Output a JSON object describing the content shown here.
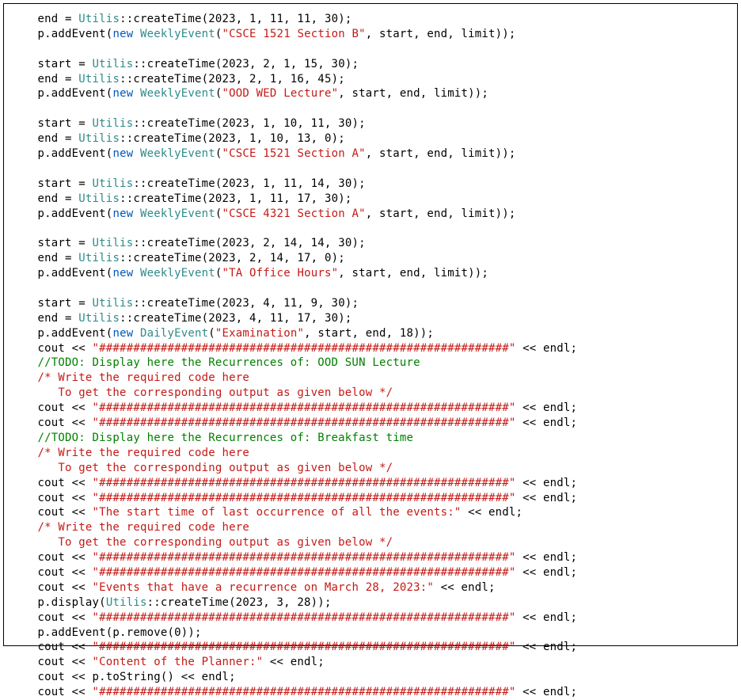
{
  "code": {
    "indent": "    ",
    "lines": [
      {
        "segs": [
          {
            "t": "end = ",
            "c": "blk"
          },
          {
            "t": "Utilis",
            "c": "tcl"
          },
          {
            "t": "::createTime(2023, 1, 11, 11, 30);",
            "c": "blk"
          }
        ]
      },
      {
        "segs": [
          {
            "t": "p.addEvent(",
            "c": "blk"
          },
          {
            "t": "new",
            "c": "kw"
          },
          {
            "t": " ",
            "c": "blk"
          },
          {
            "t": "WeeklyEvent",
            "c": "tcl"
          },
          {
            "t": "(",
            "c": "blk"
          },
          {
            "t": "\"CSCE 1521 Section B\"",
            "c": "str"
          },
          {
            "t": ", start, end, limit));",
            "c": "blk"
          }
        ]
      },
      {
        "segs": [
          {
            "t": "",
            "c": "blk"
          }
        ]
      },
      {
        "segs": [
          {
            "t": "start = ",
            "c": "blk"
          },
          {
            "t": "Utilis",
            "c": "tcl"
          },
          {
            "t": "::createTime(2023, 2, 1, 15, 30);",
            "c": "blk"
          }
        ]
      },
      {
        "segs": [
          {
            "t": "end = ",
            "c": "blk"
          },
          {
            "t": "Utilis",
            "c": "tcl"
          },
          {
            "t": "::createTime(2023, 2, 1, 16, 45);",
            "c": "blk"
          }
        ]
      },
      {
        "segs": [
          {
            "t": "p.addEvent(",
            "c": "blk"
          },
          {
            "t": "new",
            "c": "kw"
          },
          {
            "t": " ",
            "c": "blk"
          },
          {
            "t": "WeeklyEvent",
            "c": "tcl"
          },
          {
            "t": "(",
            "c": "blk"
          },
          {
            "t": "\"OOD WED Lecture\"",
            "c": "str"
          },
          {
            "t": ", start, end, limit));",
            "c": "blk"
          }
        ]
      },
      {
        "segs": [
          {
            "t": "",
            "c": "blk"
          }
        ]
      },
      {
        "segs": [
          {
            "t": "start = ",
            "c": "blk"
          },
          {
            "t": "Utilis",
            "c": "tcl"
          },
          {
            "t": "::createTime(2023, 1, 10, 11, 30);",
            "c": "blk"
          }
        ]
      },
      {
        "segs": [
          {
            "t": "end = ",
            "c": "blk"
          },
          {
            "t": "Utilis",
            "c": "tcl"
          },
          {
            "t": "::createTime(2023, 1, 10, 13, 0);",
            "c": "blk"
          }
        ]
      },
      {
        "segs": [
          {
            "t": "p.addEvent(",
            "c": "blk"
          },
          {
            "t": "new",
            "c": "kw"
          },
          {
            "t": " ",
            "c": "blk"
          },
          {
            "t": "WeeklyEvent",
            "c": "tcl"
          },
          {
            "t": "(",
            "c": "blk"
          },
          {
            "t": "\"CSCE 1521 Section A\"",
            "c": "str"
          },
          {
            "t": ", start, end, limit));",
            "c": "blk"
          }
        ]
      },
      {
        "segs": [
          {
            "t": "",
            "c": "blk"
          }
        ]
      },
      {
        "segs": [
          {
            "t": "start = ",
            "c": "blk"
          },
          {
            "t": "Utilis",
            "c": "tcl"
          },
          {
            "t": "::createTime(2023, 1, 11, 14, 30);",
            "c": "blk"
          }
        ]
      },
      {
        "segs": [
          {
            "t": "end = ",
            "c": "blk"
          },
          {
            "t": "Utilis",
            "c": "tcl"
          },
          {
            "t": "::createTime(2023, 1, 11, 17, 30);",
            "c": "blk"
          }
        ]
      },
      {
        "segs": [
          {
            "t": "p.addEvent(",
            "c": "blk"
          },
          {
            "t": "new",
            "c": "kw"
          },
          {
            "t": " ",
            "c": "blk"
          },
          {
            "t": "WeeklyEvent",
            "c": "tcl"
          },
          {
            "t": "(",
            "c": "blk"
          },
          {
            "t": "\"CSCE 4321 Section A\"",
            "c": "str"
          },
          {
            "t": ", start, end, limit));",
            "c": "blk"
          }
        ]
      },
      {
        "segs": [
          {
            "t": "",
            "c": "blk"
          }
        ]
      },
      {
        "segs": [
          {
            "t": "start = ",
            "c": "blk"
          },
          {
            "t": "Utilis",
            "c": "tcl"
          },
          {
            "t": "::createTime(2023, 2, 14, 14, 30);",
            "c": "blk"
          }
        ]
      },
      {
        "segs": [
          {
            "t": "end = ",
            "c": "blk"
          },
          {
            "t": "Utilis",
            "c": "tcl"
          },
          {
            "t": "::createTime(2023, 2, 14, 17, 0);",
            "c": "blk"
          }
        ]
      },
      {
        "segs": [
          {
            "t": "p.addEvent(",
            "c": "blk"
          },
          {
            "t": "new",
            "c": "kw"
          },
          {
            "t": " ",
            "c": "blk"
          },
          {
            "t": "WeeklyEvent",
            "c": "tcl"
          },
          {
            "t": "(",
            "c": "blk"
          },
          {
            "t": "\"TA Office Hours\"",
            "c": "str"
          },
          {
            "t": ", start, end, limit));",
            "c": "blk"
          }
        ]
      },
      {
        "segs": [
          {
            "t": "",
            "c": "blk"
          }
        ]
      },
      {
        "segs": [
          {
            "t": "start = ",
            "c": "blk"
          },
          {
            "t": "Utilis",
            "c": "tcl"
          },
          {
            "t": "::createTime(2023, 4, 11, 9, 30);",
            "c": "blk"
          }
        ]
      },
      {
        "segs": [
          {
            "t": "end = ",
            "c": "blk"
          },
          {
            "t": "Utilis",
            "c": "tcl"
          },
          {
            "t": "::createTime(2023, 4, 11, 17, 30);",
            "c": "blk"
          }
        ]
      },
      {
        "segs": [
          {
            "t": "p.addEvent(",
            "c": "blk"
          },
          {
            "t": "new",
            "c": "kw"
          },
          {
            "t": " ",
            "c": "blk"
          },
          {
            "t": "DailyEvent",
            "c": "tcl"
          },
          {
            "t": "(",
            "c": "blk"
          },
          {
            "t": "\"Examination\"",
            "c": "str"
          },
          {
            "t": ", start, end, 18));",
            "c": "blk"
          }
        ]
      },
      {
        "segs": [
          {
            "t": "cout << ",
            "c": "blk"
          },
          {
            "t": "\"############################################################\"",
            "c": "str"
          },
          {
            "t": " << endl;",
            "c": "blk"
          }
        ]
      },
      {
        "segs": [
          {
            "t": "//TODO: Display here the Recurrences of: OOD SUN Lecture",
            "c": "cmt"
          }
        ]
      },
      {
        "segs": [
          {
            "t": "/* Write the required code here",
            "c": "cmtb"
          }
        ]
      },
      {
        "segs": [
          {
            "t": "   To get the corresponding output as given below */",
            "c": "cmtb"
          }
        ]
      },
      {
        "segs": [
          {
            "t": "cout << ",
            "c": "blk"
          },
          {
            "t": "\"############################################################\"",
            "c": "str"
          },
          {
            "t": " << endl;",
            "c": "blk"
          }
        ]
      },
      {
        "segs": [
          {
            "t": "cout << ",
            "c": "blk"
          },
          {
            "t": "\"############################################################\"",
            "c": "str"
          },
          {
            "t": " << endl;",
            "c": "blk"
          }
        ]
      },
      {
        "segs": [
          {
            "t": "//TODO: Display here the Recurrences of: Breakfast time",
            "c": "cmt"
          }
        ]
      },
      {
        "segs": [
          {
            "t": "/* Write the required code here",
            "c": "cmtb"
          }
        ]
      },
      {
        "segs": [
          {
            "t": "   To get the corresponding output as given below */",
            "c": "cmtb"
          }
        ]
      },
      {
        "segs": [
          {
            "t": "cout << ",
            "c": "blk"
          },
          {
            "t": "\"############################################################\"",
            "c": "str"
          },
          {
            "t": " << endl;",
            "c": "blk"
          }
        ]
      },
      {
        "segs": [
          {
            "t": "cout << ",
            "c": "blk"
          },
          {
            "t": "\"############################################################\"",
            "c": "str"
          },
          {
            "t": " << endl;",
            "c": "blk"
          }
        ]
      },
      {
        "segs": [
          {
            "t": "cout << ",
            "c": "blk"
          },
          {
            "t": "\"The start time of last occurrence of all the events:\"",
            "c": "str"
          },
          {
            "t": " << endl;",
            "c": "blk"
          }
        ]
      },
      {
        "segs": [
          {
            "t": "/* Write the required code here",
            "c": "cmtb"
          }
        ]
      },
      {
        "segs": [
          {
            "t": "   To get the corresponding output as given below */",
            "c": "cmtb"
          }
        ]
      },
      {
        "segs": [
          {
            "t": "cout << ",
            "c": "blk"
          },
          {
            "t": "\"############################################################\"",
            "c": "str"
          },
          {
            "t": " << endl;",
            "c": "blk"
          }
        ]
      },
      {
        "segs": [
          {
            "t": "cout << ",
            "c": "blk"
          },
          {
            "t": "\"############################################################\"",
            "c": "str"
          },
          {
            "t": " << endl;",
            "c": "blk"
          }
        ]
      },
      {
        "segs": [
          {
            "t": "cout << ",
            "c": "blk"
          },
          {
            "t": "\"Events that have a recurrence on March 28, 2023:\"",
            "c": "str"
          },
          {
            "t": " << endl;",
            "c": "blk"
          }
        ]
      },
      {
        "segs": [
          {
            "t": "p.display(",
            "c": "blk"
          },
          {
            "t": "Utilis",
            "c": "tcl"
          },
          {
            "t": "::createTime(2023, 3, 28));",
            "c": "blk"
          }
        ]
      },
      {
        "segs": [
          {
            "t": "cout << ",
            "c": "blk"
          },
          {
            "t": "\"############################################################\"",
            "c": "str"
          },
          {
            "t": " << endl;",
            "c": "blk"
          }
        ]
      },
      {
        "segs": [
          {
            "t": "p.addEvent(p.remove(0));",
            "c": "blk"
          }
        ]
      },
      {
        "segs": [
          {
            "t": "cout << ",
            "c": "blk"
          },
          {
            "t": "\"############################################################\"",
            "c": "str"
          },
          {
            "t": " << endl;",
            "c": "blk"
          }
        ]
      },
      {
        "segs": [
          {
            "t": "cout << ",
            "c": "blk"
          },
          {
            "t": "\"Content of the Planner:\"",
            "c": "str"
          },
          {
            "t": " << endl;",
            "c": "blk"
          }
        ]
      },
      {
        "segs": [
          {
            "t": "cout << p.toString() << endl;",
            "c": "blk"
          }
        ]
      },
      {
        "segs": [
          {
            "t": "cout << ",
            "c": "blk"
          },
          {
            "t": "\"############################################################\"",
            "c": "str"
          },
          {
            "t": " << endl;",
            "c": "blk"
          }
        ]
      }
    ]
  }
}
